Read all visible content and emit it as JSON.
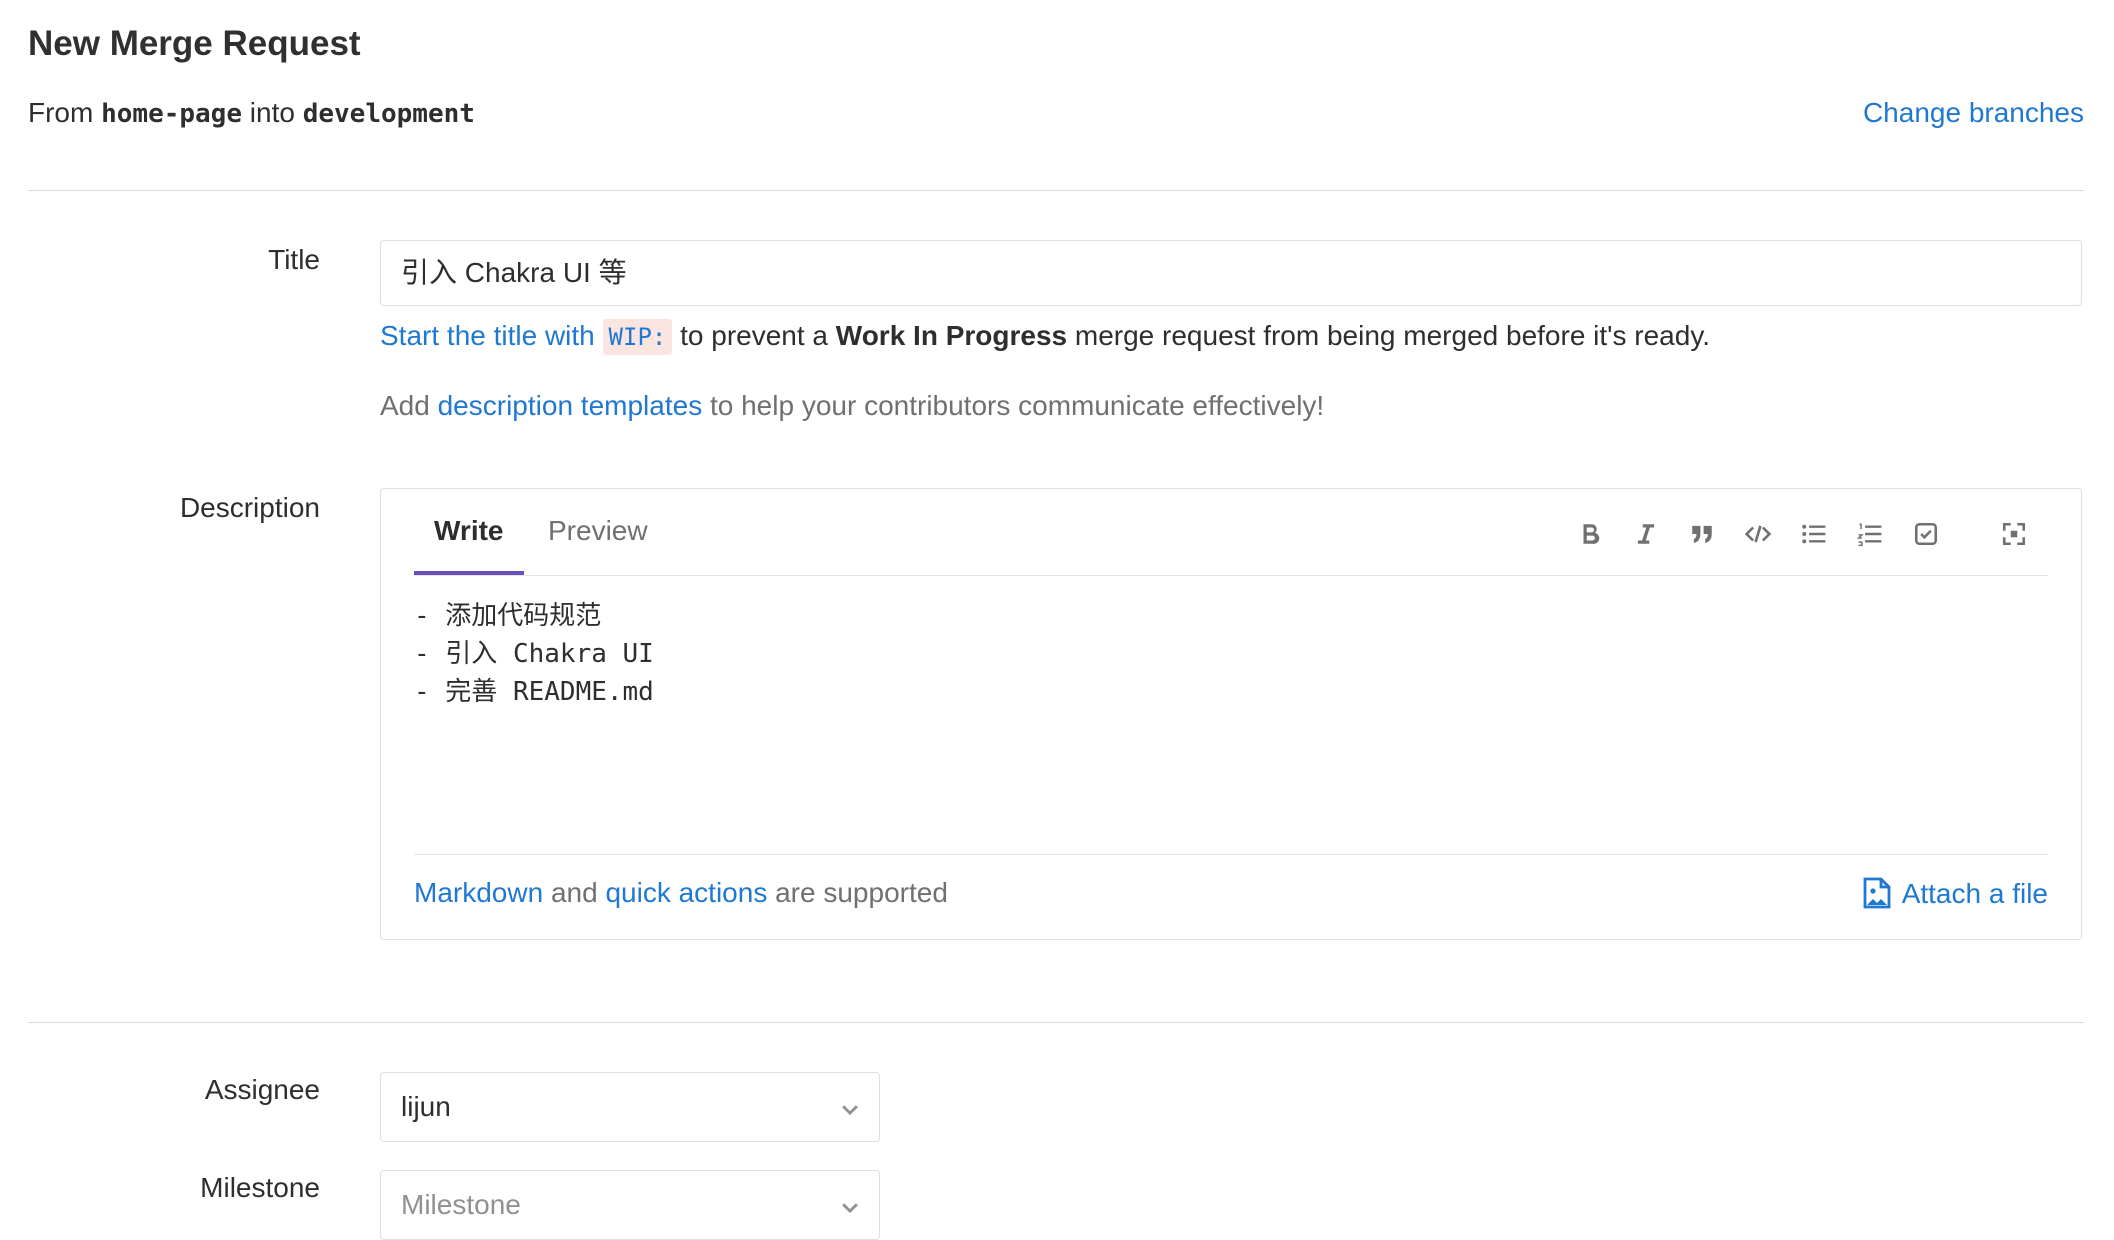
{
  "header": {
    "title": "New Merge Request",
    "from_label": "From",
    "source_branch": "home-page",
    "into_label": "into",
    "target_branch": "development",
    "change_branches": "Change branches"
  },
  "title_field": {
    "label": "Title",
    "value": "引入 Chakra UI 等",
    "wip_link": "Start the title with",
    "wip_code": "WIP:",
    "wip_mid": "to prevent a",
    "wip_bold": "Work In Progress",
    "wip_end": "merge request from being merged before it's ready.",
    "tmpl_prefix": "Add",
    "tmpl_link": "description templates",
    "tmpl_suffix": "to help your contributors communicate effectively!"
  },
  "description": {
    "label": "Description",
    "tab_write": "Write",
    "tab_preview": "Preview",
    "toolbar": [
      "bold-icon",
      "italic-icon",
      "quote-icon",
      "code-icon",
      "bullet-list-icon",
      "numbered-list-icon",
      "task-list-icon",
      "fullscreen-icon"
    ],
    "content": "- 添加代码规范\n- 引入 Chakra UI\n- 完善 README.md",
    "markdown_link": "Markdown",
    "and_text": "and",
    "quick_actions_link": "quick actions",
    "supported_text": "are supported",
    "attach_file": "Attach a file"
  },
  "assignee": {
    "label": "Assignee",
    "value": "lijun"
  },
  "milestone": {
    "label": "Milestone",
    "placeholder": "Milestone"
  },
  "colors": {
    "link": "#1f78d1",
    "active_tab": "#6b4fbb"
  }
}
